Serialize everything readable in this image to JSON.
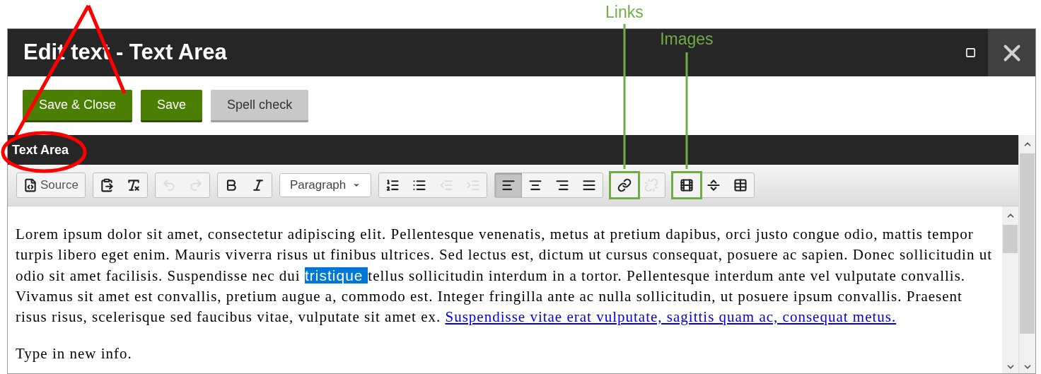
{
  "window": {
    "title": "Edit text - Text Area"
  },
  "buttons": [
    {
      "label": "Save & Close",
      "kind": "primary"
    },
    {
      "label": "Save",
      "kind": "primary"
    },
    {
      "label": "Spell check",
      "kind": "secondary"
    }
  ],
  "editor": {
    "label": "Text Area",
    "toolbar": [
      [
        {
          "kind": "source",
          "label": "Source",
          "selected": false,
          "disabled": false
        }
      ],
      [
        {
          "kind": "paste-word",
          "selected": false,
          "disabled": false
        },
        {
          "kind": "remove-format",
          "selected": false,
          "disabled": false
        }
      ],
      [
        {
          "kind": "undo",
          "selected": false,
          "disabled": true
        },
        {
          "kind": "redo",
          "selected": false,
          "disabled": true
        }
      ],
      [
        {
          "kind": "bold",
          "selected": false,
          "disabled": false
        },
        {
          "kind": "italic",
          "selected": false,
          "disabled": false
        }
      ],
      [
        {
          "kind": "format",
          "label": "Paragraph"
        }
      ],
      [
        {
          "kind": "numbered-list",
          "selected": false,
          "disabled": false
        },
        {
          "kind": "bulleted-list",
          "selected": false,
          "disabled": false
        },
        {
          "kind": "outdent",
          "selected": false,
          "disabled": true
        },
        {
          "kind": "indent",
          "selected": false,
          "disabled": true
        }
      ],
      [
        {
          "kind": "align-left",
          "selected": true,
          "disabled": false
        },
        {
          "kind": "align-center",
          "selected": false,
          "disabled": false
        },
        {
          "kind": "align-right",
          "selected": false,
          "disabled": false
        },
        {
          "kind": "justify",
          "selected": false,
          "disabled": false
        }
      ],
      [
        {
          "kind": "link",
          "selected": false,
          "disabled": false,
          "callout": "Links"
        },
        {
          "kind": "unlink",
          "selected": false,
          "disabled": true
        }
      ],
      [
        {
          "kind": "image",
          "selected": false,
          "disabled": false,
          "callout": "Images"
        },
        {
          "kind": "horizontal-rule",
          "selected": false,
          "disabled": false
        },
        {
          "kind": "table",
          "selected": false,
          "disabled": false
        }
      ]
    ],
    "paragraphs": [
      {
        "parts": [
          {
            "kind": "plain",
            "text": "Lorem ipsum dolor sit amet, consectetur adipiscing elit. Pellentesque venenatis, metus at pretium dapibus, orci justo congue odio, mattis tempor turpis libero eget enim. Mauris viverra risus ut finibus ultrices. Sed lectus est, dictum ut cursus consequat, posuere ac sapien. Donec sollicitudin ut odio sit amet facilisis. Suspendisse nec dui "
          },
          {
            "kind": "selected",
            "text": "tristique "
          },
          {
            "kind": "plain",
            "text": "tellus sollicitudin interdum in a tortor. Pellentesque interdum ante vel vulputate convallis. Vivamus sit amet est convallis, pretium augue a, commodo est. Integer fringilla ante ac nulla sollicitudin, ut posuere ipsum convallis. Praesent risus risus, scelerisque sed faucibus vitae, vulputate sit amet ex. "
          },
          {
            "kind": "link",
            "text": "Suspendisse vitae erat vulputate, sagittis quam ac, consequat metus."
          }
        ]
      },
      {
        "parts": [
          {
            "kind": "plain",
            "text": "Type in new info."
          }
        ]
      }
    ]
  }
}
